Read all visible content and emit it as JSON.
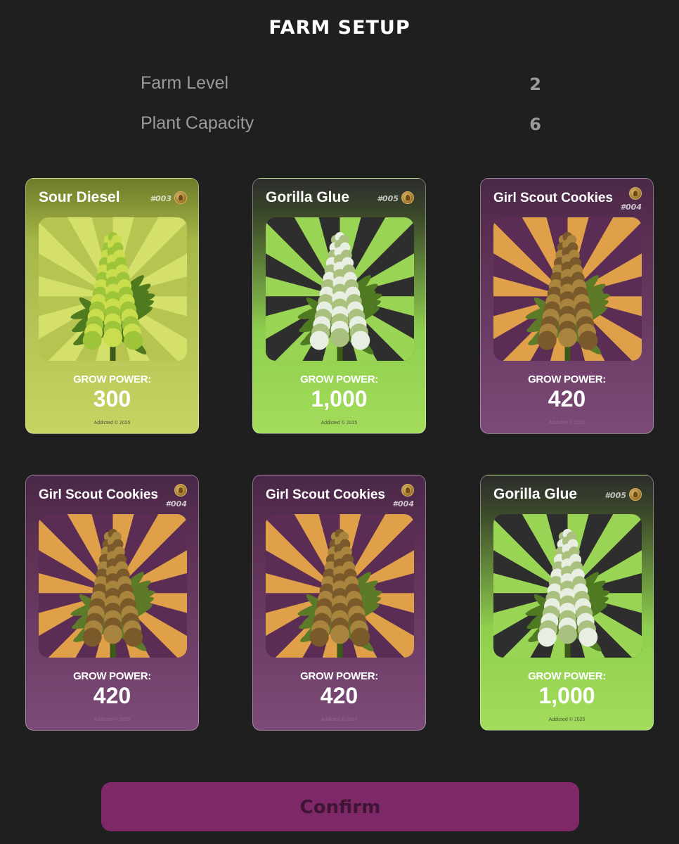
{
  "header": {
    "title": "FARM SETUP"
  },
  "stats": [
    {
      "label": "Farm Level",
      "value": "2"
    },
    {
      "label": "Plant Capacity",
      "value": "6"
    }
  ],
  "cards": [
    {
      "name": "Sour Diesel",
      "id": "#003",
      "theme": "yellow",
      "grow_power_label": "GROW POWER:",
      "grow_power": "300",
      "footer": "Addicted © 2025"
    },
    {
      "name": "Gorilla Glue",
      "id": "#005",
      "theme": "green",
      "grow_power_label": "GROW POWER:",
      "grow_power": "1,000",
      "footer": "Addicted © 2025"
    },
    {
      "name": "Girl Scout Cookies",
      "id": "#004",
      "theme": "purple",
      "grow_power_label": "GROW POWER:",
      "grow_power": "420",
      "footer": "Addicted © 2025"
    },
    {
      "name": "Girl Scout Cookies",
      "id": "#004",
      "theme": "purple",
      "grow_power_label": "GROW POWER:",
      "grow_power": "420",
      "footer": "Addicted © 2025"
    },
    {
      "name": "Girl Scout Cookies",
      "id": "#004",
      "theme": "purple",
      "grow_power_label": "GROW POWER:",
      "grow_power": "420",
      "footer": "Addicted © 2025"
    },
    {
      "name": "Gorilla Glue",
      "id": "#005",
      "theme": "green",
      "grow_power_label": "GROW POWER:",
      "grow_power": "1,000",
      "footer": "Addicted © 2025"
    }
  ],
  "confirm_button": {
    "label": "Confirm"
  },
  "colors": {
    "background": "#1f1f1f",
    "confirm_bg": "#7e2868",
    "confirm_text": "#3f1435",
    "theme_yellow": "#b5c454",
    "theme_green": "#98d552",
    "theme_purple": "#6e3e69"
  },
  "icons": {
    "card_badge": "coin-leaf-icon",
    "card_art": "cannabis-plant-icon"
  }
}
